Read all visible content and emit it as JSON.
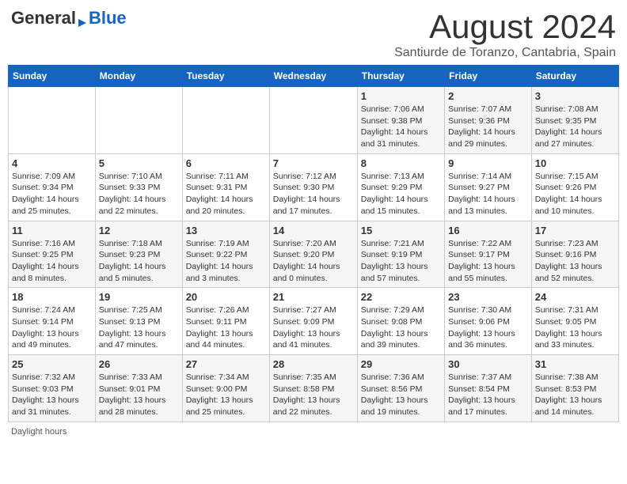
{
  "header": {
    "logo_general": "General",
    "logo_blue": "Blue",
    "title": "August 2024",
    "subtitle": "Santiurde de Toranzo, Cantabria, Spain"
  },
  "days_of_week": [
    "Sunday",
    "Monday",
    "Tuesday",
    "Wednesday",
    "Thursday",
    "Friday",
    "Saturday"
  ],
  "weeks": [
    [
      {
        "day": "",
        "info": ""
      },
      {
        "day": "",
        "info": ""
      },
      {
        "day": "",
        "info": ""
      },
      {
        "day": "",
        "info": ""
      },
      {
        "day": "1",
        "info": "Sunrise: 7:06 AM\nSunset: 9:38 PM\nDaylight: 14 hours and 31 minutes."
      },
      {
        "day": "2",
        "info": "Sunrise: 7:07 AM\nSunset: 9:36 PM\nDaylight: 14 hours and 29 minutes."
      },
      {
        "day": "3",
        "info": "Sunrise: 7:08 AM\nSunset: 9:35 PM\nDaylight: 14 hours and 27 minutes."
      }
    ],
    [
      {
        "day": "4",
        "info": "Sunrise: 7:09 AM\nSunset: 9:34 PM\nDaylight: 14 hours and 25 minutes."
      },
      {
        "day": "5",
        "info": "Sunrise: 7:10 AM\nSunset: 9:33 PM\nDaylight: 14 hours and 22 minutes."
      },
      {
        "day": "6",
        "info": "Sunrise: 7:11 AM\nSunset: 9:31 PM\nDaylight: 14 hours and 20 minutes."
      },
      {
        "day": "7",
        "info": "Sunrise: 7:12 AM\nSunset: 9:30 PM\nDaylight: 14 hours and 17 minutes."
      },
      {
        "day": "8",
        "info": "Sunrise: 7:13 AM\nSunset: 9:29 PM\nDaylight: 14 hours and 15 minutes."
      },
      {
        "day": "9",
        "info": "Sunrise: 7:14 AM\nSunset: 9:27 PM\nDaylight: 14 hours and 13 minutes."
      },
      {
        "day": "10",
        "info": "Sunrise: 7:15 AM\nSunset: 9:26 PM\nDaylight: 14 hours and 10 minutes."
      }
    ],
    [
      {
        "day": "11",
        "info": "Sunrise: 7:16 AM\nSunset: 9:25 PM\nDaylight: 14 hours and 8 minutes."
      },
      {
        "day": "12",
        "info": "Sunrise: 7:18 AM\nSunset: 9:23 PM\nDaylight: 14 hours and 5 minutes."
      },
      {
        "day": "13",
        "info": "Sunrise: 7:19 AM\nSunset: 9:22 PM\nDaylight: 14 hours and 3 minutes."
      },
      {
        "day": "14",
        "info": "Sunrise: 7:20 AM\nSunset: 9:20 PM\nDaylight: 14 hours and 0 minutes."
      },
      {
        "day": "15",
        "info": "Sunrise: 7:21 AM\nSunset: 9:19 PM\nDaylight: 13 hours and 57 minutes."
      },
      {
        "day": "16",
        "info": "Sunrise: 7:22 AM\nSunset: 9:17 PM\nDaylight: 13 hours and 55 minutes."
      },
      {
        "day": "17",
        "info": "Sunrise: 7:23 AM\nSunset: 9:16 PM\nDaylight: 13 hours and 52 minutes."
      }
    ],
    [
      {
        "day": "18",
        "info": "Sunrise: 7:24 AM\nSunset: 9:14 PM\nDaylight: 13 hours and 49 minutes."
      },
      {
        "day": "19",
        "info": "Sunrise: 7:25 AM\nSunset: 9:13 PM\nDaylight: 13 hours and 47 minutes."
      },
      {
        "day": "20",
        "info": "Sunrise: 7:26 AM\nSunset: 9:11 PM\nDaylight: 13 hours and 44 minutes."
      },
      {
        "day": "21",
        "info": "Sunrise: 7:27 AM\nSunset: 9:09 PM\nDaylight: 13 hours and 41 minutes."
      },
      {
        "day": "22",
        "info": "Sunrise: 7:29 AM\nSunset: 9:08 PM\nDaylight: 13 hours and 39 minutes."
      },
      {
        "day": "23",
        "info": "Sunrise: 7:30 AM\nSunset: 9:06 PM\nDaylight: 13 hours and 36 minutes."
      },
      {
        "day": "24",
        "info": "Sunrise: 7:31 AM\nSunset: 9:05 PM\nDaylight: 13 hours and 33 minutes."
      }
    ],
    [
      {
        "day": "25",
        "info": "Sunrise: 7:32 AM\nSunset: 9:03 PM\nDaylight: 13 hours and 31 minutes."
      },
      {
        "day": "26",
        "info": "Sunrise: 7:33 AM\nSunset: 9:01 PM\nDaylight: 13 hours and 28 minutes."
      },
      {
        "day": "27",
        "info": "Sunrise: 7:34 AM\nSunset: 9:00 PM\nDaylight: 13 hours and 25 minutes."
      },
      {
        "day": "28",
        "info": "Sunrise: 7:35 AM\nSunset: 8:58 PM\nDaylight: 13 hours and 22 minutes."
      },
      {
        "day": "29",
        "info": "Sunrise: 7:36 AM\nSunset: 8:56 PM\nDaylight: 13 hours and 19 minutes."
      },
      {
        "day": "30",
        "info": "Sunrise: 7:37 AM\nSunset: 8:54 PM\nDaylight: 13 hours and 17 minutes."
      },
      {
        "day": "31",
        "info": "Sunrise: 7:38 AM\nSunset: 8:53 PM\nDaylight: 13 hours and 14 minutes."
      }
    ]
  ],
  "footer": {
    "daylight_label": "Daylight hours"
  }
}
